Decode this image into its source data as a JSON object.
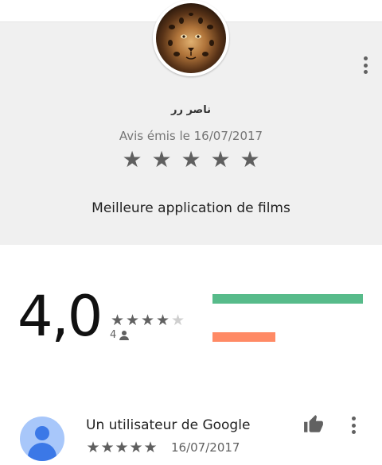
{
  "review": {
    "reviewer_name": "ناصر رر",
    "date_text": "Avis émis le 16/07/2017",
    "rating_stars": 5,
    "text": "Meilleure application de films"
  },
  "summary": {
    "rating": "4,0",
    "stars": 4,
    "count": "4",
    "bars": [
      {
        "color": "#57bb8a",
        "fraction": 1.0
      },
      {
        "color": "#ff8a65",
        "fraction": 0.42
      }
    ]
  },
  "user_review": {
    "name": "Un utilisateur de Google",
    "rating_stars": 5,
    "date": "16/07/2017"
  },
  "icons": {
    "overflow": "more-vert-icon",
    "thumb": "thumb-up-icon",
    "person": "person-icon",
    "star": "star-icon"
  },
  "colors": {
    "card_background": "#f0f0f0",
    "star": "#5f5f5f",
    "bar_green": "#57bb8a",
    "bar_orange": "#ff8a65",
    "avatar_blue": "#3b78e7"
  }
}
